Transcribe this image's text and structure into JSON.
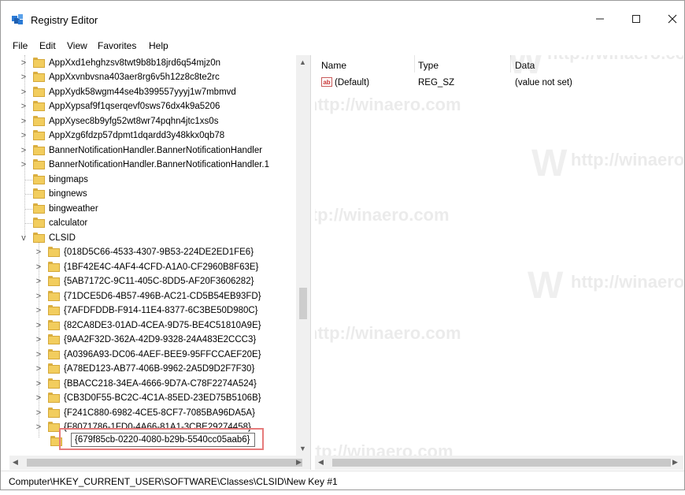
{
  "window": {
    "title": "Registry Editor"
  },
  "menu": [
    "File",
    "Edit",
    "View",
    "Favorites",
    "Help"
  ],
  "tree": {
    "items": [
      {
        "label": "AppXxd1ehghzsv8twt9b8b18jrd6q54mjz0n",
        "level": 1,
        "expander": ">"
      },
      {
        "label": "AppXxvnbvsna403aer8rg6v5h12z8c8te2rc",
        "level": 1,
        "expander": ">"
      },
      {
        "label": "AppXydk58wgm44se4b399557yyyj1w7mbmvd",
        "level": 1,
        "expander": ">"
      },
      {
        "label": "AppXypsaf9f1qserqevf0sws76dx4k9a5206",
        "level": 1,
        "expander": ">"
      },
      {
        "label": "AppXysec8b9yfg52wt8wr74pqhn4jtc1xs0s",
        "level": 1,
        "expander": ">"
      },
      {
        "label": "AppXzg6fdzp57dpmt1dqardd3y48kkx0qb78",
        "level": 1,
        "expander": ">"
      },
      {
        "label": "BannerNotificationHandler.BannerNotificationHandler",
        "level": 1,
        "expander": ">"
      },
      {
        "label": "BannerNotificationHandler.BannerNotificationHandler.1",
        "level": 1,
        "expander": ">"
      },
      {
        "label": "bingmaps",
        "level": 1,
        "expander": ""
      },
      {
        "label": "bingnews",
        "level": 1,
        "expander": ""
      },
      {
        "label": "bingweather",
        "level": 1,
        "expander": ""
      },
      {
        "label": "calculator",
        "level": 1,
        "expander": ""
      },
      {
        "label": "CLSID",
        "level": 1,
        "expander": "v"
      },
      {
        "label": "{018D5C66-4533-4307-9B53-224DE2ED1FE6}",
        "level": 2,
        "expander": ">"
      },
      {
        "label": "{1BF42E4C-4AF4-4CFD-A1A0-CF2960B8F63E}",
        "level": 2,
        "expander": ">"
      },
      {
        "label": "{5AB7172C-9C11-405C-8DD5-AF20F3606282}",
        "level": 2,
        "expander": ">"
      },
      {
        "label": "{71DCE5D6-4B57-496B-AC21-CD5B54EB93FD}",
        "level": 2,
        "expander": ">"
      },
      {
        "label": "{7AFDFDDB-F914-11E4-8377-6C3BE50D980C}",
        "level": 2,
        "expander": ">"
      },
      {
        "label": "{82CA8DE3-01AD-4CEA-9D75-BE4C51810A9E}",
        "level": 2,
        "expander": ">"
      },
      {
        "label": "{9AA2F32D-362A-42D9-9328-24A483E2CCC3}",
        "level": 2,
        "expander": ">"
      },
      {
        "label": "{A0396A93-DC06-4AEF-BEE9-95FFCCAEF20E}",
        "level": 2,
        "expander": ">"
      },
      {
        "label": "{A78ED123-AB77-406B-9962-2A5D9D2F7F30}",
        "level": 2,
        "expander": ">"
      },
      {
        "label": "{BBACC218-34EA-4666-9D7A-C78F2274A524}",
        "level": 2,
        "expander": ">"
      },
      {
        "label": "{CB3D0F55-BC2C-4C1A-85ED-23ED75B5106B}",
        "level": 2,
        "expander": ">"
      },
      {
        "label": "{F241C880-6982-4CE5-8CF7-7085BA96DA5A}",
        "level": 2,
        "expander": ">"
      },
      {
        "label": "{F8071786-1FD0-4A66-81A1-3CBE29274458}",
        "level": 2,
        "expander": ">"
      }
    ],
    "editing_key": "{679f85cb-0220-4080-b29b-5540cc05aab6}"
  },
  "values_pane": {
    "columns": [
      "Name",
      "Type",
      "Data"
    ],
    "rows": [
      {
        "name": "(Default)",
        "type": "REG_SZ",
        "data": "(value not set)",
        "icon": "string-value-icon"
      }
    ]
  },
  "status": {
    "path": "Computer\\HKEY_CURRENT_USER\\SOFTWARE\\Classes\\CLSID\\New Key #1"
  },
  "watermark": "http://winaero.com",
  "colors": {
    "folder": "#f2cd5e",
    "highlight": "#e67b7b",
    "ab_icon": "#c83232"
  }
}
